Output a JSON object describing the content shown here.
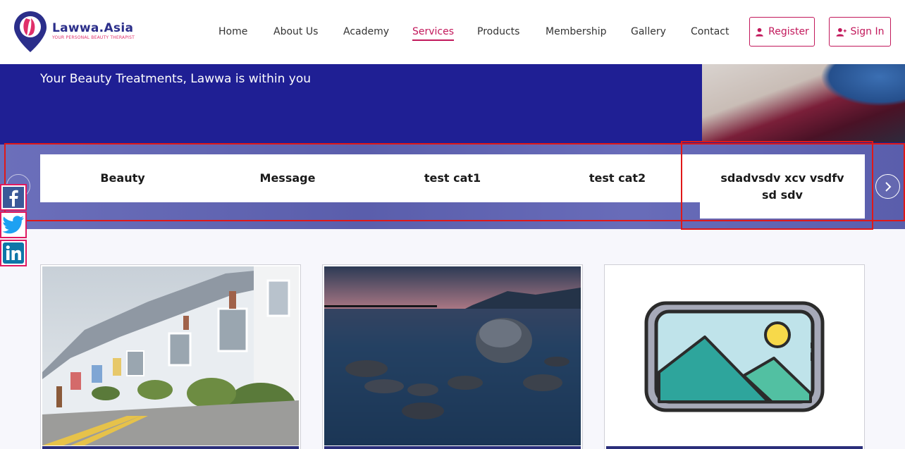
{
  "brand": {
    "name": "Lawwa.Asia",
    "tagline": "YOUR PERSONAL BEAUTY THERAPIST",
    "colors": {
      "navy": "#2b2e8a",
      "accent": "#c2185b",
      "hero": "#1f1f94"
    }
  },
  "nav": {
    "items": [
      "Home",
      "About Us",
      "Academy",
      "Services",
      "Products",
      "Membership",
      "Gallery",
      "Contact"
    ],
    "active": "Services"
  },
  "auth": {
    "register_label": "Register",
    "register_icon": "user-icon",
    "signin_label": "Sign In",
    "signin_icon": "user-plus-icon"
  },
  "hero": {
    "subtitle": "Your Beauty Treatments, Lawwa is within you"
  },
  "categories": {
    "tabs": [
      "Beauty",
      "Message",
      "test cat1",
      "test cat2",
      "sdadvsdv xcv vsdfv sd sdv"
    ],
    "selected": "sdadvsdv xcv vsdfv sd sdv",
    "next_icon": "chevron-right-icon",
    "prev_icon": "chevron-left-icon"
  },
  "social": [
    "facebook-icon",
    "twitter-icon",
    "linkedin-icon"
  ],
  "cards": [
    {
      "image": "street-houses-photo"
    },
    {
      "image": "lake-rocks-photo"
    },
    {
      "image": "image-placeholder-icon"
    }
  ]
}
